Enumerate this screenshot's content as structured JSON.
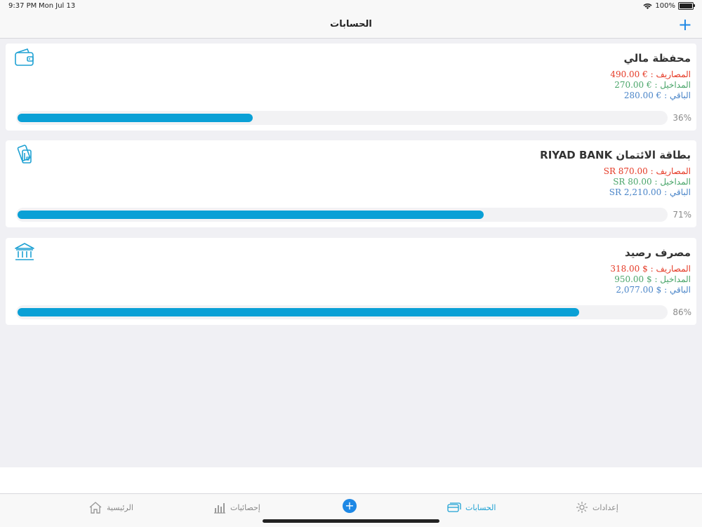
{
  "status": {
    "time": "9:37 PM",
    "date": "Mon Jul 13",
    "battery": "100%"
  },
  "nav": {
    "title": "الحسابات",
    "add": "+"
  },
  "accounts": [
    {
      "name": "محفظة مالي",
      "expenses": "المصاريف : € 490.00",
      "income": "المداخيل : € 270.00",
      "remaining": "الباقي : € 280.00",
      "percent_label": "36%",
      "percent": 36
    },
    {
      "name": "بطاقة الائتمان  RIYAD BANK",
      "expenses": "المصاريف : SR 870.00",
      "income": "المداخيل : SR 80.00",
      "remaining": "الباقي : SR 2,210.00",
      "percent_label": "71%",
      "percent": 71
    },
    {
      "name": "مصرف رصيد",
      "expenses": "المصاريف : $ 318.00",
      "income": "المداخيل : $ 950.00",
      "remaining": "الباقي : $ 2,077.00",
      "percent_label": "86%",
      "percent": 86
    }
  ],
  "tabs": {
    "home": "الرئيسية",
    "stats": "إحصائيات",
    "add": "+",
    "accounts": "الحسابات",
    "settings": "إعدادات"
  },
  "colors": {
    "accent": "#1ea1d3",
    "expense": "#e53925",
    "income": "#4aa56a",
    "remaining": "#4a85c8",
    "progress": "#0aa0d6"
  }
}
